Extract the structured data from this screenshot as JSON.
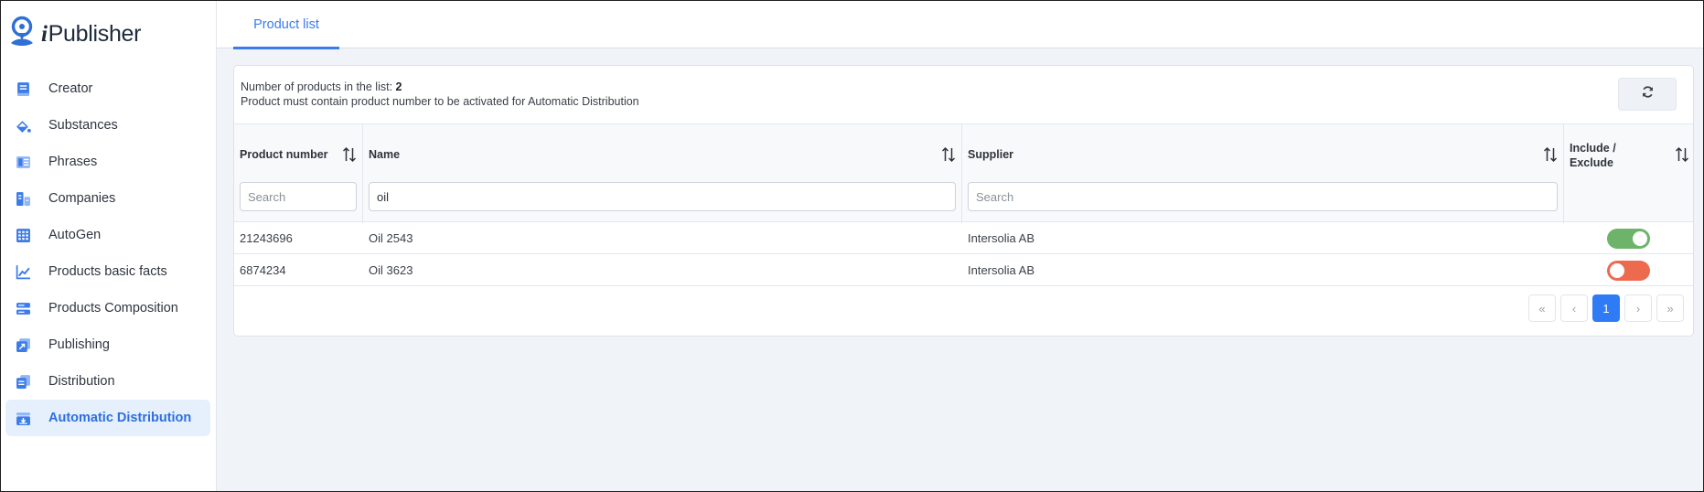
{
  "app": {
    "name": "Publisher",
    "name_prefix": "i",
    "logo_icon": "logo-icon"
  },
  "sidebar": {
    "items": [
      {
        "label": "Creator",
        "icon": "book-icon",
        "active": false
      },
      {
        "label": "Substances",
        "icon": "flask-icon",
        "active": false
      },
      {
        "label": "Phrases",
        "icon": "list-icon",
        "active": false
      },
      {
        "label": "Companies",
        "icon": "buildings-icon",
        "active": false
      },
      {
        "label": "AutoGen",
        "icon": "grid-icon",
        "active": false
      },
      {
        "label": "Products basic facts",
        "icon": "chart-line-icon",
        "active": false
      },
      {
        "label": "Products Composition",
        "icon": "layers-icon",
        "active": false
      },
      {
        "label": "Publishing",
        "icon": "share-icon",
        "active": false
      },
      {
        "label": "Distribution",
        "icon": "copy-icon",
        "active": false
      },
      {
        "label": "Automatic Distribution",
        "icon": "inbox-download-icon",
        "active": true
      }
    ]
  },
  "tabs": [
    {
      "label": "Product list",
      "active": true
    }
  ],
  "list_info": {
    "count_label": "Number of products in the list:",
    "count_value": "2",
    "note": "Product must contain product number to be activated for Automatic Distribution"
  },
  "table": {
    "columns": [
      {
        "label": "Product number",
        "filter_value": "",
        "filter_placeholder": "Search"
      },
      {
        "label": "Name",
        "filter_value": "oil",
        "filter_placeholder": "Search"
      },
      {
        "label": "Supplier",
        "filter_value": "",
        "filter_placeholder": "Search"
      },
      {
        "label": "Include / Exclude"
      }
    ],
    "rows": [
      {
        "product_number": "21243696",
        "name": "Oil 2543",
        "supplier": "Intersolia AB",
        "included": true
      },
      {
        "product_number": "6874234",
        "name": "Oil 3623",
        "supplier": "Intersolia AB",
        "included": false
      }
    ]
  },
  "pagination": {
    "first": "«",
    "prev": "‹",
    "current": "1",
    "next": "›",
    "last": "»"
  },
  "colors": {
    "accent": "#3b7bea",
    "toggle_on": "#6db46a",
    "toggle_off": "#ee6a4f",
    "active_nav_bg": "#e6effc",
    "page_bg": "#f0f4f9"
  }
}
